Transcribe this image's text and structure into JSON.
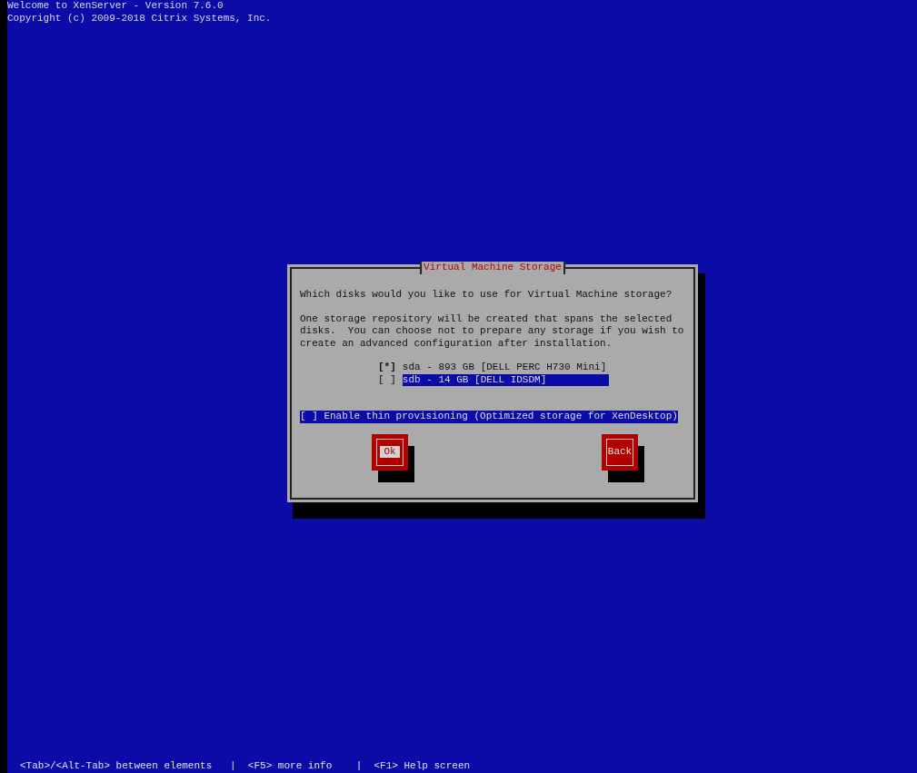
{
  "header": [
    "Welcome to XenServer - Version 7.6.0",
    "Copyright (c) 2009-2018 Citrix Systems, Inc."
  ],
  "dialog": {
    "title": "Virtual Machine Storage",
    "question": "Which disks would you like to use for Virtual Machine storage?",
    "description": [
      "One storage repository will be created that spans the selected",
      "disks.  You can choose not to prepare any storage if you wish to",
      "create an advanced configuration after installation."
    ],
    "disks": [
      {
        "mark": "[*]",
        "label": "sda - 893 GB [DELL PERC H730 Mini]",
        "checked": true,
        "selected": false
      },
      {
        "mark": "[ ]",
        "label": "sdb - 14 GB [DELL IDSDM]",
        "checked": false,
        "selected": true
      }
    ],
    "thin_provisioning": {
      "label": "[ ] Enable thin provisioning (Optimized storage for XenDesktop)",
      "checked": false,
      "selected": true
    },
    "buttons": [
      {
        "label": "Ok",
        "selected": true
      },
      {
        "label": "Back",
        "selected": false
      }
    ]
  },
  "footer": "<Tab>/<Alt-Tab> between elements   |  <F5> more info    |  <F1> Help screen"
}
